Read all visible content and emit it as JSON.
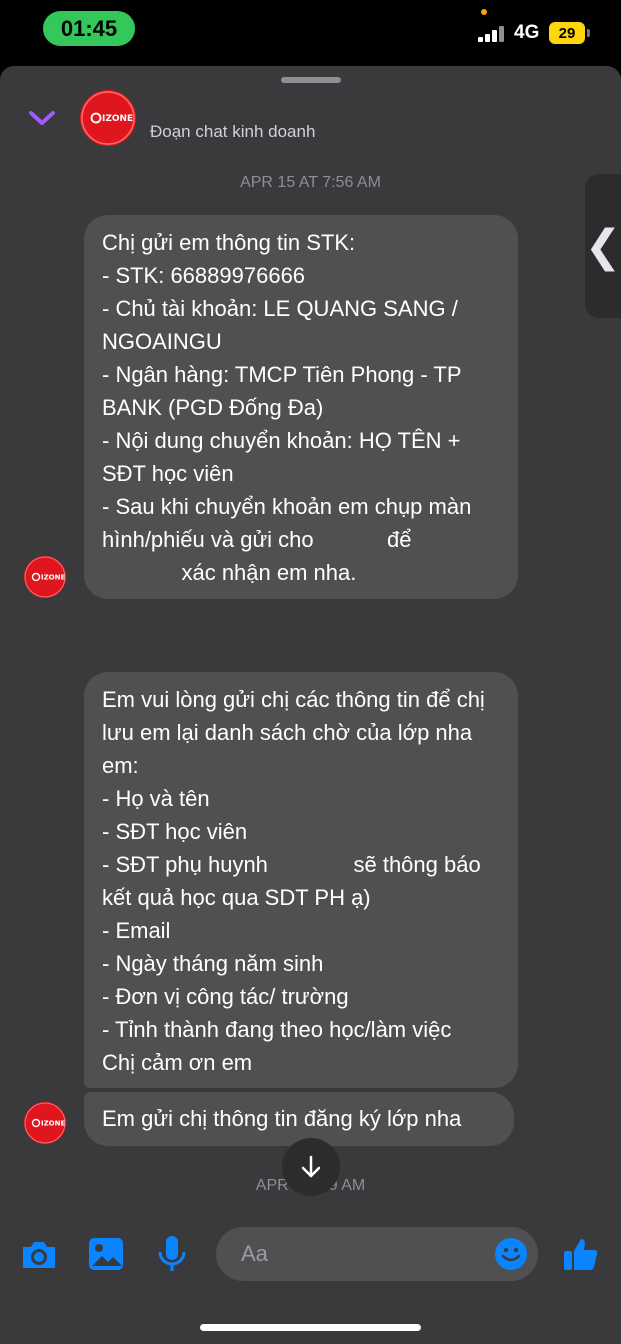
{
  "status": {
    "time": "01:45",
    "network": "4G",
    "battery": "29"
  },
  "header": {
    "title": "Đoạn chat kinh doanh",
    "avatar_text": "IZONE"
  },
  "messages": {
    "timestamp_1": "APR 15 AT 7:56 AM",
    "bubble_1": "Chị gửi em thông tin STK:\n- STK: 66889976666\n- Chủ tài khoản: LE QUANG SANG / NGOAINGU\n- Ngân hàng: TMCP Tiên Phong - TP BANK (PGD Đống Đa)\n- Nội dung chuyển khoản: HỌ TÊN + SĐT học viên\n- Sau khi chuyển khoản em chụp màn hình/phiếu và gửi cho            để\n             xác nhận em nha.",
    "bubble_2": "Em vui lòng gửi chị các thông tin để chị lưu em lại danh sách chờ của lớp nha em:\n- Họ và tên\n- SĐT học viên\n- SĐT phụ huynh              sẽ thông báo kết quả học qua SDT PH ạ)\n- Email\n- Ngày tháng năm sinh\n- Đơn vị công tác/ trường\n- Tỉnh thành đang theo học/làm việc\nChị cảm ơn em",
    "bubble_3": "Em gửi chị thông tin đăng ký lớp nha",
    "timestamp_2": "APR 15      :49 AM"
  },
  "composer": {
    "placeholder": "Aa"
  },
  "icons": {
    "collapse": "chevron-down-icon",
    "camera": "camera-icon",
    "gallery": "image-icon",
    "mic": "microphone-icon",
    "emoji": "emoji-icon",
    "like": "thumbs-up-icon",
    "scroll": "arrow-down-icon",
    "side": "chevron-left-icon"
  },
  "colors": {
    "accent": "#0a84ff",
    "collapse": "#a259ff",
    "avatar": "#e0161f",
    "bubble": "#505053",
    "time_pill": "#34c759"
  }
}
